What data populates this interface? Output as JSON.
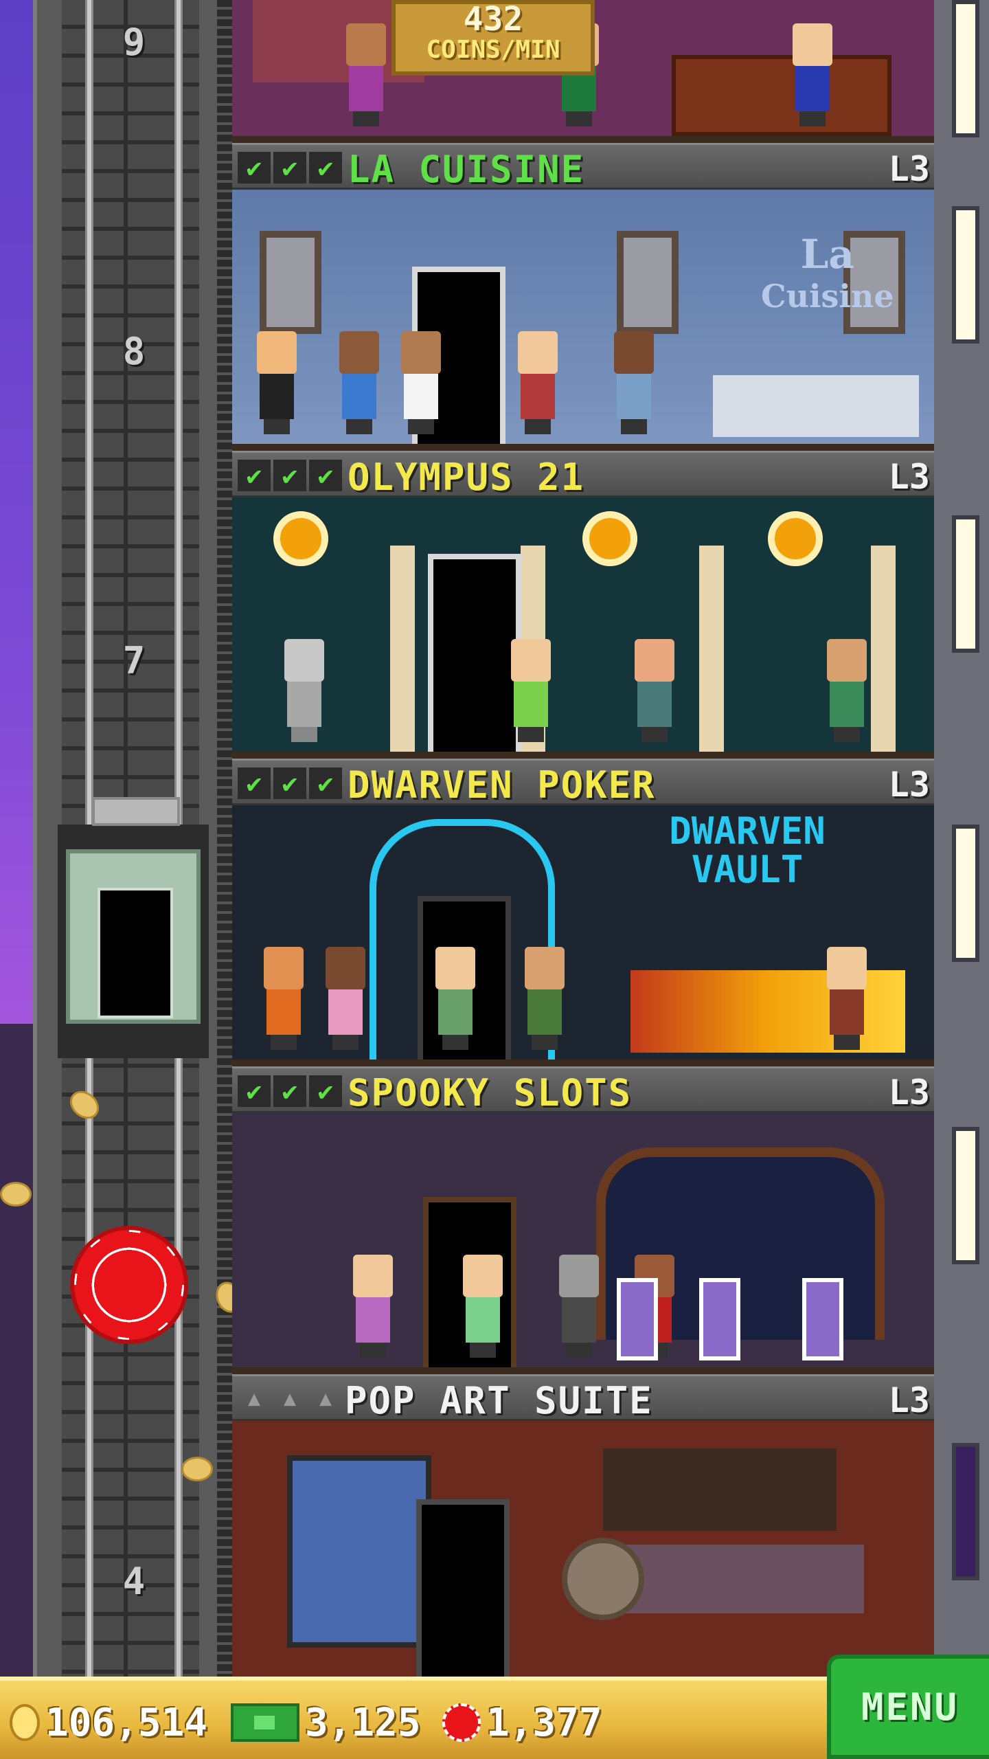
{
  "top_banner": {
    "value": "432",
    "label": "COINS/MIN"
  },
  "elevator_floors": [
    "9",
    "8",
    "7",
    "4"
  ],
  "floors": [
    {
      "name": "LA CUISINE",
      "level": "L3",
      "stars": 3,
      "name_color": "#5fe046",
      "sign": [
        "La",
        "Cuisine"
      ]
    },
    {
      "name": "OLYMPUS 21",
      "level": "L3",
      "stars": 3,
      "name_color": "#f3e94b"
    },
    {
      "name": "DWARVEN POKER",
      "level": "L3",
      "stars": 3,
      "name_color": "#f3e94b",
      "sign": [
        "DWARVEN",
        "VAULT"
      ]
    },
    {
      "name": "SPOOKY SLOTS",
      "level": "L3",
      "stars": 3,
      "name_color": "#f3e94b"
    },
    {
      "name": "POP ART SUITE",
      "level": "L3",
      "stars": 0,
      "name_color": "#f2f2f2"
    }
  ],
  "currency": {
    "coins": "106,514",
    "bux": "3,125",
    "chips": "1,377"
  },
  "menu_label": "MENU",
  "icons": [
    "coin-icon",
    "bux-icon",
    "chip-icon",
    "check-icon"
  ]
}
